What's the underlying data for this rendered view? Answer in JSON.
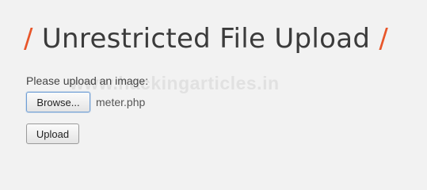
{
  "heading": {
    "left_slash": "/",
    "title": "Unrestricted File Upload",
    "right_slash": "/"
  },
  "form": {
    "prompt": "Please upload an image:",
    "browse_label": "Browse...",
    "selected_file": "meter.php",
    "upload_label": "Upload"
  },
  "watermark": "www.hackingarticles.in",
  "colors": {
    "accent": "#e8562a",
    "background": "#f2f2f2"
  }
}
